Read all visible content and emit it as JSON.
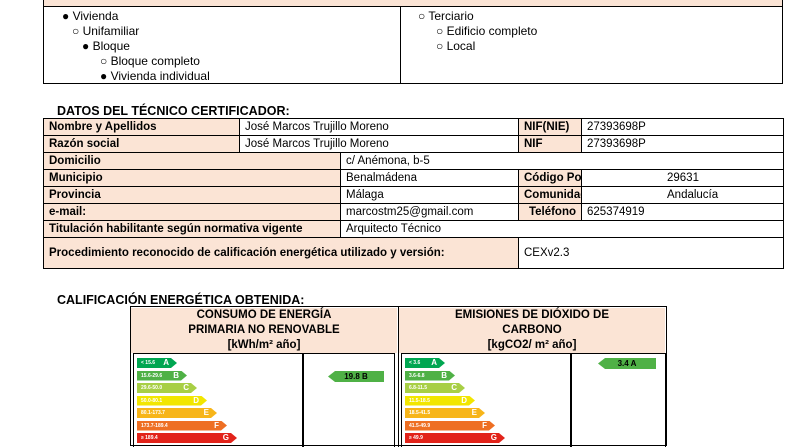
{
  "building_type": {
    "left": [
      "● Vivienda",
      "○ Unifamiliar",
      "● Bloque",
      "○ Bloque completo",
      "● Vivienda individual"
    ],
    "right": [
      "○ Terciario",
      "○ Edificio completo",
      "○ Local"
    ]
  },
  "tecnico": {
    "section_title": "DATOS DEL TÉCNICO CERTIFICADOR:",
    "nombre_label": "Nombre y Apellidos",
    "nombre_value": "José Marcos Trujillo Moreno",
    "nif_nie_label": "NIF(NIE)",
    "nif_nie_value": "27393698P",
    "razon_label": "Razón social",
    "razon_value": "José Marcos Trujillo Moreno",
    "nif_label": "NIF",
    "nif_value": "27393698P",
    "domicilio_label": "Domicilio",
    "domicilio_value": "c/ Anémona, b-5",
    "municipio_label": "Municipio",
    "municipio_value": "Benalmádena",
    "cp_label": "Código Postal",
    "cp_value": "29631",
    "provincia_label": "Provincia",
    "provincia_value": "Málaga",
    "ca_label": "Comunidad Autónoma",
    "ca_value": "Andalucía",
    "email_label": "e-mail:",
    "email_value": "marcostm25@gmail.com",
    "tel_label": "Teléfono",
    "tel_value": "625374919",
    "titulacion_label": "Titulación habilitante según normativa vigente",
    "titulacion_value": "Arquitecto Técnico",
    "procedimiento_label": "Procedimiento reconocido de calificación energética utilizado y versión:",
    "procedimiento_value": "CEXv2.3"
  },
  "calificacion": {
    "section_title": "CALIFICACIÓN ENERGÉTICA OBTENIDA:",
    "consumo": {
      "title_line1": "CONSUMO DE ENERGÍA",
      "title_line2": "PRIMARIA NO RENOVABLE",
      "unit": "[kWh/m² año]",
      "bars": [
        {
          "range": "< 15.6",
          "letter": "A",
          "color": "#00a651"
        },
        {
          "range": "15.6-29.6",
          "letter": "B",
          "color": "#4fb146"
        },
        {
          "range": "29.6-50.0",
          "letter": "C",
          "color": "#a8cf45"
        },
        {
          "range": "50.0-80.1",
          "letter": "D",
          "color": "#f2e600"
        },
        {
          "range": "80.1-173.7",
          "letter": "E",
          "color": "#f7b519"
        },
        {
          "range": "173.7-189.4",
          "letter": "F",
          "color": "#ee6f23"
        },
        {
          "range": "≥ 189.4",
          "letter": "G",
          "color": "#e2231a"
        }
      ],
      "indicator": "19.8 B"
    },
    "emisiones": {
      "title_line1": "EMISIONES DE DIÓXIDO DE",
      "title_line2": "CARBONO",
      "unit": "[kgCO2/ m² año]",
      "bars": [
        {
          "range": "< 3.6",
          "letter": "A",
          "color": "#00a651"
        },
        {
          "range": "3.6-6.8",
          "letter": "B",
          "color": "#4fb146"
        },
        {
          "range": "6.8-11.5",
          "letter": "C",
          "color": "#a8cf45"
        },
        {
          "range": "11.5-18.5",
          "letter": "D",
          "color": "#f2e600"
        },
        {
          "range": "18.5-41.5",
          "letter": "E",
          "color": "#f7b519"
        },
        {
          "range": "41.5-49.9",
          "letter": "F",
          "color": "#ee6f23"
        },
        {
          "range": "≥ 49.9",
          "letter": "G",
          "color": "#e2231a"
        }
      ],
      "indicator": "3.4 A"
    }
  }
}
